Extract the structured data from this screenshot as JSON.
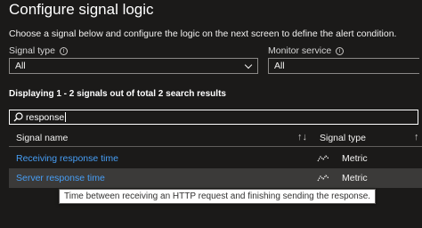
{
  "header": {
    "title": "Configure signal logic",
    "intro": "Choose a signal below and configure the logic on the next screen to define the alert condition."
  },
  "filters": {
    "signal_type": {
      "label": "Signal type",
      "value": "All",
      "icon": "info-icon"
    },
    "monitor_service": {
      "label": "Monitor service",
      "value": "All",
      "icon": "info-icon"
    }
  },
  "results": {
    "summary": "Displaying 1 - 2 signals out of total 2 search results"
  },
  "search": {
    "value": "response",
    "icon": "search-icon"
  },
  "table": {
    "columns": [
      {
        "label": "Signal name",
        "sort_icon": "sort-icon"
      },
      {
        "label": "Signal type",
        "sort_icon": "sort-icon"
      }
    ],
    "rows": [
      {
        "name": "Receiving response time",
        "type": "Metric",
        "type_icon": "metric-icon",
        "selected": false
      },
      {
        "name": "Server response time",
        "type": "Metric",
        "type_icon": "metric-icon",
        "selected": true
      }
    ]
  },
  "tooltip": {
    "text": "Time between receiving an HTTP request and finishing sending the response."
  },
  "colors": {
    "background": "#1b1a19",
    "link": "#479ef5",
    "selected_row": "#3b3a39",
    "border": "#8a8886"
  }
}
